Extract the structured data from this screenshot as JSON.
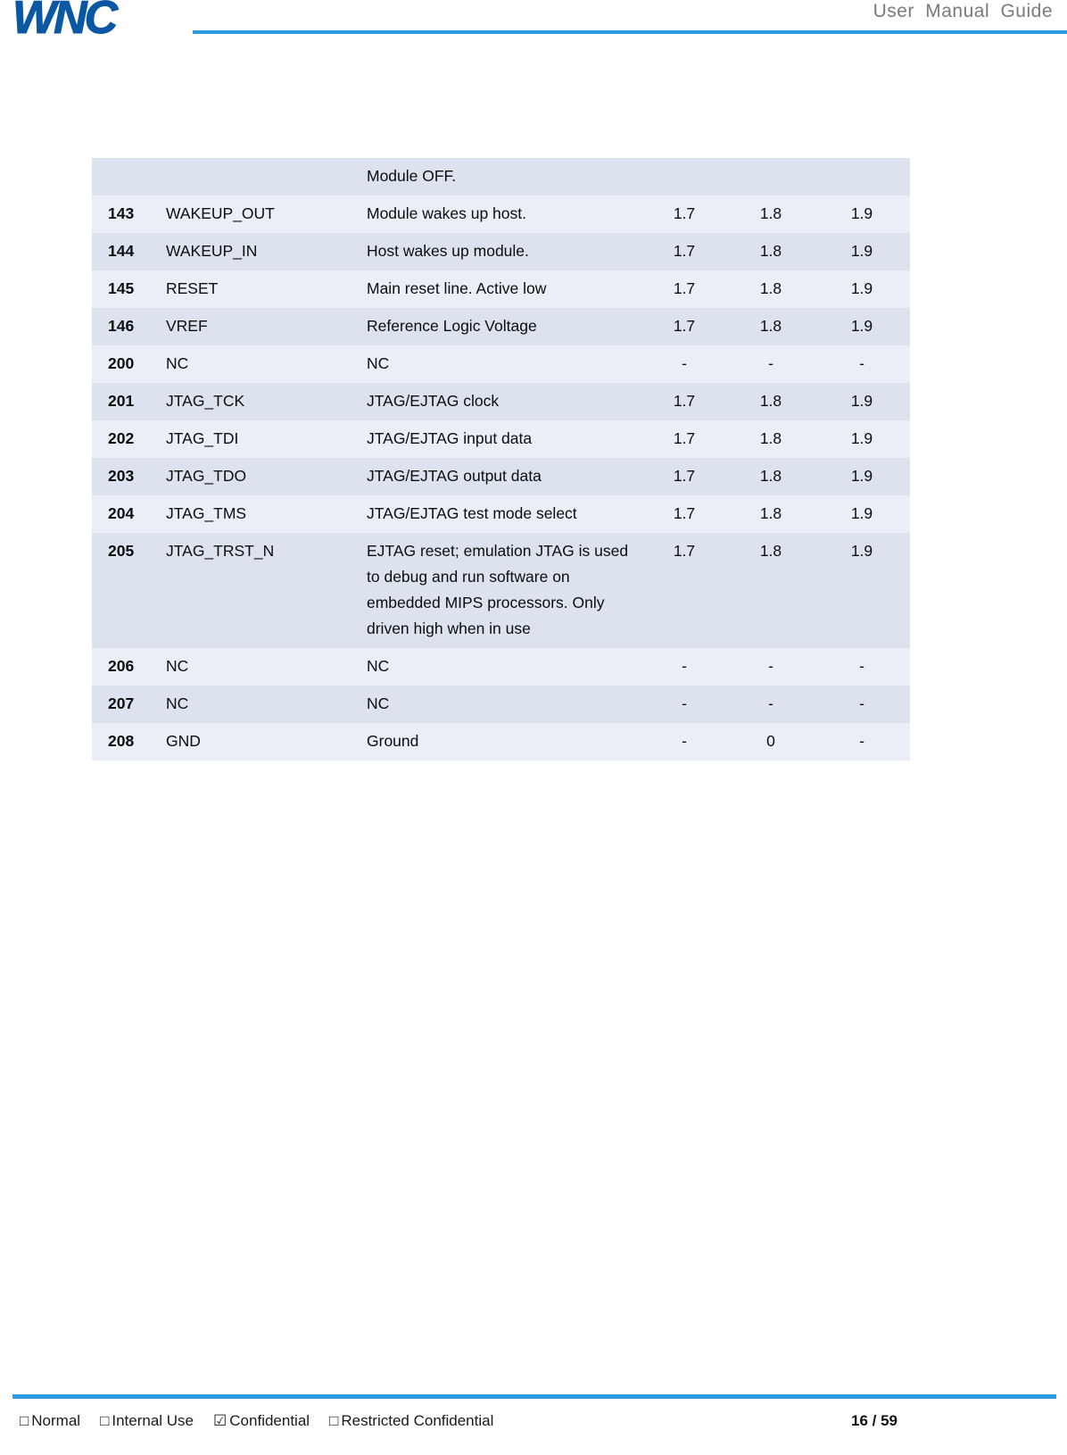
{
  "header": {
    "logo_text": "WNC",
    "title": "User  Manual  Guide"
  },
  "table": {
    "continued_row_text": "Module OFF.",
    "rows": [
      {
        "pin": "143",
        "name": "WAKEUP_OUT",
        "desc": "Module wakes up host.",
        "min": "1.7",
        "typ": "1.8",
        "max": "1.9"
      },
      {
        "pin": "144",
        "name": "WAKEUP_IN",
        "desc": "Host wakes up module.",
        "min": "1.7",
        "typ": "1.8",
        "max": "1.9"
      },
      {
        "pin": "145",
        "name": "RESET",
        "desc": "Main reset line. Active low",
        "min": "1.7",
        "typ": "1.8",
        "max": "1.9"
      },
      {
        "pin": "146",
        "name": "VREF",
        "desc": "Reference Logic Voltage",
        "min": "1.7",
        "typ": "1.8",
        "max": "1.9"
      },
      {
        "pin": "200",
        "name": "NC",
        "desc": "NC",
        "min": "-",
        "typ": "-",
        "max": "-"
      },
      {
        "pin": "201",
        "name": "JTAG_TCK",
        "desc": "JTAG/EJTAG clock",
        "min": "1.7",
        "typ": "1.8",
        "max": "1.9"
      },
      {
        "pin": "202",
        "name": "JTAG_TDI",
        "desc": "JTAG/EJTAG input data",
        "min": "1.7",
        "typ": "1.8",
        "max": "1.9"
      },
      {
        "pin": "203",
        "name": "JTAG_TDO",
        "desc": "JTAG/EJTAG output data",
        "min": "1.7",
        "typ": "1.8",
        "max": "1.9"
      },
      {
        "pin": "204",
        "name": "JTAG_TMS",
        "desc": "JTAG/EJTAG test mode select",
        "min": "1.7",
        "typ": "1.8",
        "max": "1.9"
      },
      {
        "pin": "205",
        "name": "JTAG_TRST_N",
        "desc": "EJTAG reset; emulation JTAG is used to debug and run software on embedded MIPS processors. Only driven high when in use",
        "min": "1.7",
        "typ": "1.8",
        "max": "1.9",
        "multiline": true
      },
      {
        "pin": "206",
        "name": "NC",
        "desc": "NC",
        "min": "-",
        "typ": "-",
        "max": "-"
      },
      {
        "pin": "207",
        "name": "NC",
        "desc": "NC",
        "min": "-",
        "typ": "-",
        "max": "-"
      },
      {
        "pin": "208",
        "name": "GND",
        "desc": "Ground",
        "min": "-",
        "typ": "0",
        "max": "-"
      }
    ]
  },
  "footer": {
    "classifications": [
      {
        "box": "□",
        "label": "Normal",
        "checked": false
      },
      {
        "box": "□",
        "label": "Internal Use",
        "checked": false
      },
      {
        "box": "☑",
        "label": "Confidential",
        "checked": true
      },
      {
        "box": "□",
        "label": "Restricted Confidential",
        "checked": false
      }
    ],
    "page_number": "16 / 59"
  },
  "colors": {
    "logo_blue": "#0a57a4",
    "rule_blue": "#2b9ae0",
    "row_light": "#eaeef7",
    "row_dark": "#dce3ef",
    "header_title_gray": "#7a7a7a"
  }
}
